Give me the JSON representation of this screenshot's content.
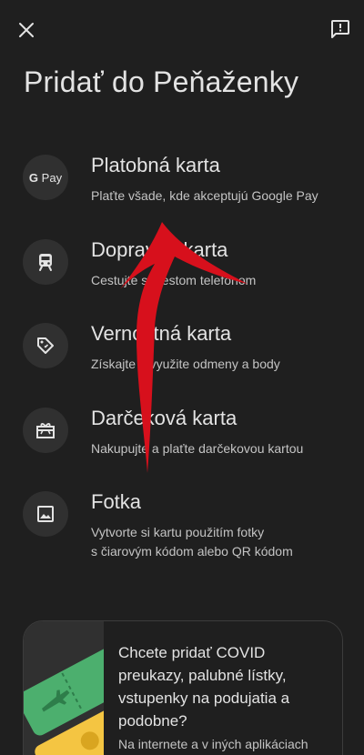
{
  "header": {
    "title": "Pridať do Peňaženky",
    "close_icon": "close-icon",
    "feedback_icon": "feedback-icon"
  },
  "options": [
    {
      "title": "Platobná karta",
      "subtitle": "Plaťte všade, kde akceptujú Google Pay",
      "icon": "gpay-icon",
      "icon_text": "Pay"
    },
    {
      "title": "Dopravná karta",
      "subtitle": "Cestujte s mestom telefónom",
      "icon": "train-icon"
    },
    {
      "title": "Vernostná karta",
      "subtitle": "Získajte a využite odmeny a body",
      "icon": "tag-icon"
    },
    {
      "title": "Darčeková karta",
      "subtitle": "Nakupujte a plaťte darčekovou kartou",
      "icon": "gift-icon"
    },
    {
      "title": "Fotka",
      "subtitle_line1": "Vytvorte si kartu použitím fotky",
      "subtitle_line2": "s čiarovým kódom alebo QR kódom",
      "icon": "photo-icon"
    }
  ],
  "promo": {
    "title": "Chcete pridať COVID preukazy, palubné lístky, vstupenky na podujatia a podobne?",
    "subtitle": "Na internete a v iných aplikáciach",
    "icon": "ticket-illustration"
  },
  "colors": {
    "background": "#1f1f1f",
    "icon_circle": "#303030",
    "text_primary": "#e3e3e3",
    "text_secondary": "#c4c4c4",
    "annotation_arrow": "#d7101c"
  }
}
